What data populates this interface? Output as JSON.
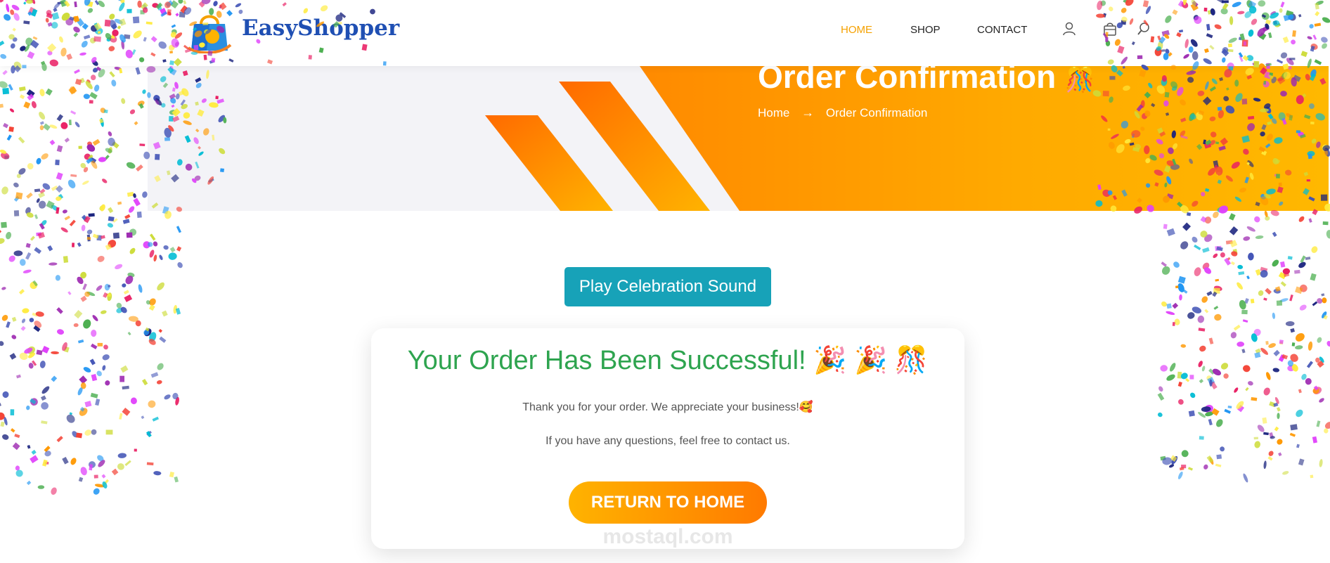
{
  "header": {
    "brand": "EasyShopper",
    "nav": [
      {
        "label": "HOME",
        "active": true
      },
      {
        "label": "SHOP",
        "active": false
      },
      {
        "label": "CONTACT",
        "active": false
      }
    ],
    "icons": [
      "user-icon",
      "cart-icon",
      "search-icon"
    ]
  },
  "banner": {
    "title": "Order Confirmation",
    "title_emoji": "🎊",
    "breadcrumb": {
      "home": "Home",
      "separator": "→",
      "current": "Order Confirmation"
    }
  },
  "actions": {
    "play_sound_label": "Play Celebration Sound"
  },
  "card": {
    "title": "Your Order Has Been Successful! 🎉 🎉 🎊",
    "thanks": "Thank you for your order. We appreciate your business!🥰",
    "questions": "If you have any questions, feel free to contact us.",
    "return_label": "RETURN TO HOME"
  },
  "watermark": "mostaql.com",
  "colors": {
    "accent_orange": "#ff7a00",
    "accent_yellow": "#ffb300",
    "teal_button": "#17a2b8",
    "success_green": "#2ea44f",
    "brand_blue": "#1f4fb3",
    "nav_active": "#f5a100"
  }
}
